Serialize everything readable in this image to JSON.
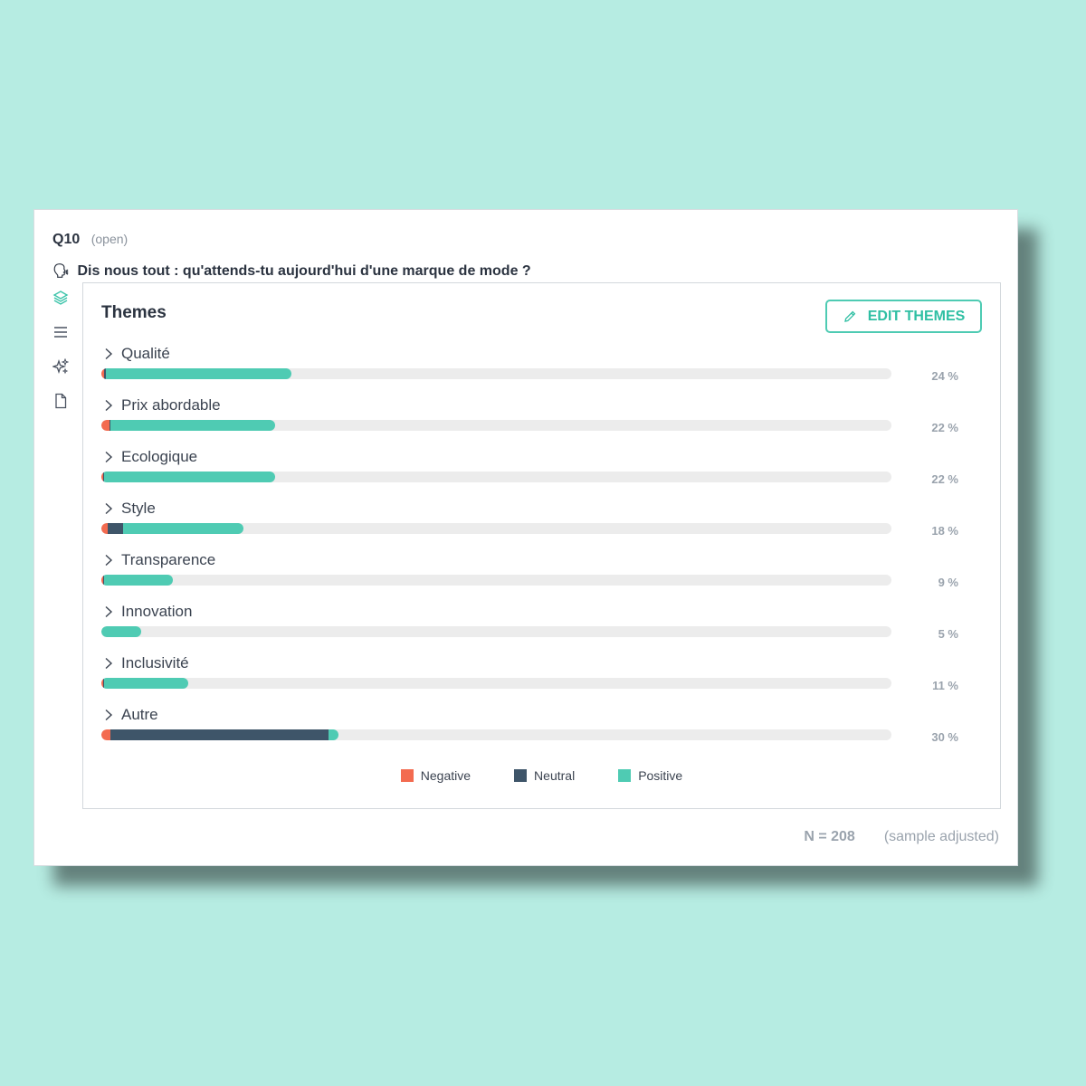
{
  "question": {
    "number": "Q10",
    "type": "(open)",
    "text": "Dis nous tout : qu'attends-tu aujourd'hui d'une marque de mode ?",
    "icon": "speaking-head-icon"
  },
  "sidebar": {
    "icons": [
      "layers-icon",
      "list-icon",
      "sparkles-icon",
      "document-icon"
    ]
  },
  "panel": {
    "title": "Themes",
    "edit_button": "EDIT THEMES"
  },
  "colors": {
    "negative": "#f36b50",
    "neutral": "#3e5569",
    "positive": "#4fcbb3",
    "track": "#ececec"
  },
  "chart_data": {
    "type": "bar",
    "orientation": "horizontal",
    "stacked": true,
    "categories": [
      "Qualité",
      "Prix abordable",
      "Ecologique",
      "Style",
      "Transparence",
      "Innovation",
      "Inclusivité",
      "Autre"
    ],
    "labels": [
      "24 %",
      "22 %",
      "22 %",
      "18 %",
      "9 %",
      "5 %",
      "11 %",
      "30 %"
    ],
    "totals": [
      24,
      22,
      22,
      18,
      9,
      5,
      11,
      30
    ],
    "series": [
      {
        "name": "Negative",
        "values": [
          0.4,
          1.0,
          0.2,
          0.8,
          0.2,
          0.0,
          0.2,
          1.2
        ]
      },
      {
        "name": "Neutral",
        "values": [
          0.2,
          0.2,
          0.1,
          1.9,
          0.2,
          0.0,
          0.2,
          27.6
        ]
      },
      {
        "name": "Positive",
        "values": [
          23.4,
          20.8,
          21.7,
          15.3,
          8.6,
          5.0,
          10.6,
          1.2
        ]
      }
    ],
    "xlim": [
      0,
      100
    ],
    "legend_position": "bottom-center"
  },
  "footer": {
    "n": "N = 208",
    "note": "(sample adjusted)"
  }
}
